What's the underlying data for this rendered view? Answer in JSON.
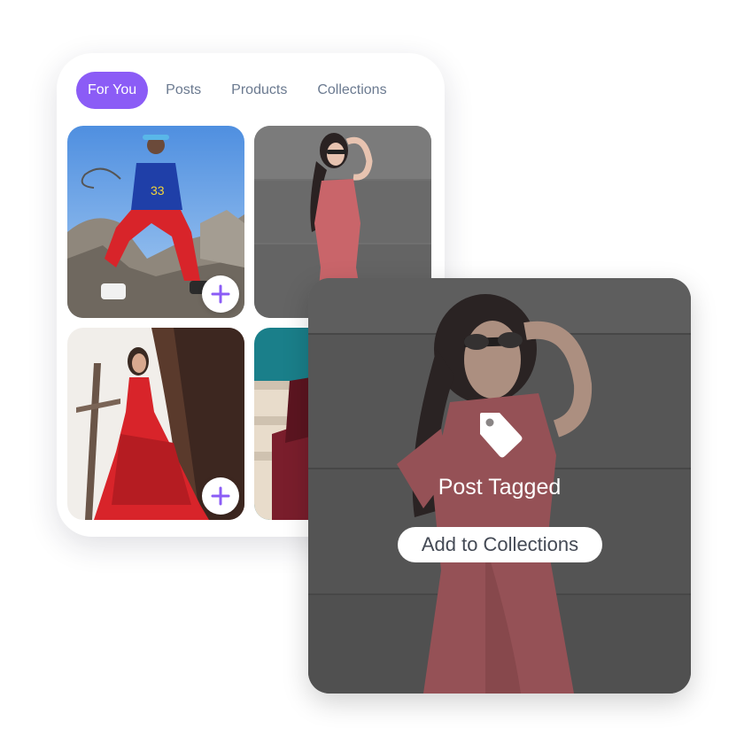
{
  "tabs": [
    {
      "label": "For You",
      "active": true
    },
    {
      "label": "Posts",
      "active": false
    },
    {
      "label": "Products",
      "active": false
    },
    {
      "label": "Collections",
      "active": false
    }
  ],
  "accent_color": "#8b5cf6",
  "feed": {
    "items": [
      {
        "name": "man-on-rocks-photo",
        "add_icon": "plus-icon",
        "add_visible": true
      },
      {
        "name": "woman-pink-dress-photo",
        "add_icon": "plus-icon",
        "add_visible": false
      },
      {
        "name": "woman-red-gown-photo",
        "add_icon": "plus-icon",
        "add_visible": true
      },
      {
        "name": "person-on-stairs-photo",
        "add_icon": "plus-icon",
        "add_visible": false
      }
    ]
  },
  "overlay": {
    "icon": "tag-icon",
    "status": "Post Tagged",
    "button_label": "Add to Collections"
  }
}
